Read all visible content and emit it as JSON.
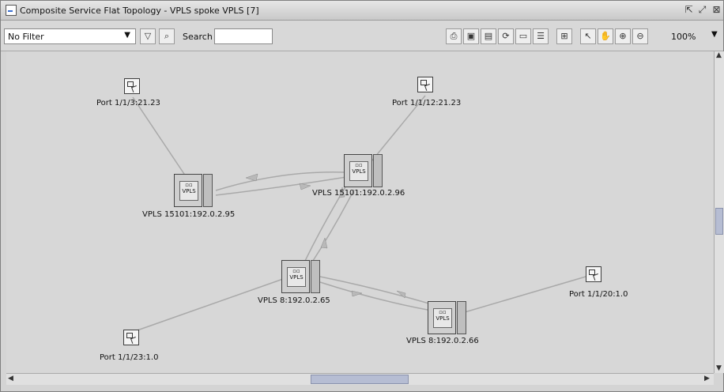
{
  "window": {
    "title": "Composite Service Flat Topology - VPLS spoke VPLS [7]"
  },
  "toolbar": {
    "filter_value": "No Filter",
    "search_label": "Search",
    "search_value": "",
    "zoom_value": "100%",
    "icons": [
      "filter-icon",
      "find-icon",
      "print-icon",
      "save-icon",
      "export-icon",
      "refresh-icon",
      "window-icon",
      "properties-icon",
      "layout-icon",
      "pointer-icon",
      "pan-icon",
      "zoom-in-icon",
      "zoom-out-icon"
    ]
  },
  "topology": {
    "nodes": [
      {
        "label": "Port 1/1/3:21.23"
      },
      {
        "label": "Port 1/1/12:21.23"
      },
      {
        "label": "VPLS 15101:192.0.2.95"
      },
      {
        "label": "VPLS 15101:192.0.2.96"
      },
      {
        "label": "VPLS 8:192.0.2.65"
      },
      {
        "label": "VPLS 8:192.0.2.66"
      },
      {
        "label": "Port 1/1/20:1.0"
      },
      {
        "label": "Port 1/1/23:1.0"
      }
    ]
  },
  "colors": {
    "canvas_bg": "#d7d7d7",
    "link": "#a9a9a9"
  }
}
